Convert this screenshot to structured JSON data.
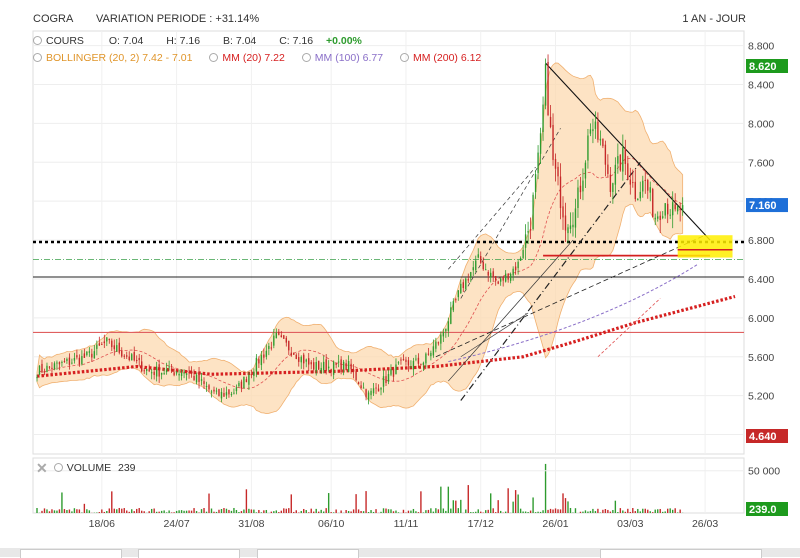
{
  "header": {
    "symbol": "COGRA",
    "variation": "VARIATION PERIODE : +31.14%",
    "period": "1 AN - JOUR"
  },
  "legend": {
    "cours_label": "COURS",
    "open": "O: 7.04",
    "high": "H: 7.16",
    "low": "B: 7.04",
    "close": "C: 7.16",
    "change": "+0.00%",
    "bollinger": "BOLLINGER (20, 2)  7.42 - 7.01",
    "mm20": "MM (20)  7.22",
    "mm100": "MM (100)  6.77",
    "mm200": "MM (200)  6.12"
  },
  "volume_panel": {
    "label": "VOLUME",
    "value": "239"
  },
  "colors": {
    "up": "#2e9b2e",
    "down": "#c62828",
    "band_fill": "#fcd9b0",
    "band_stroke": "#f0b070",
    "mm20": "#e05050",
    "mm100": "#8a6fc8",
    "mm200": "#d62020",
    "last_price_bg": "#1e6fd8",
    "high_badge_bg": "#1d9a1d",
    "low_badge_bg": "#c62828",
    "highlight": "#ffee00"
  },
  "chart_data": {
    "type": "candlestick",
    "y_ticks": [
      "8.800",
      "8.400",
      "8.000",
      "7.600",
      "7.200",
      "6.800",
      "6.400",
      "6.000",
      "5.600",
      "5.200",
      "4.800"
    ],
    "x_ticks": [
      "18/06",
      "24/07",
      "31/08",
      "06/10",
      "11/11",
      "17/12",
      "26/01",
      "03/03",
      "26/03"
    ],
    "ylim": [
      4.6,
      8.95
    ],
    "last_price": "7.160",
    "max_badge": "8.620",
    "min_badge": "4.640",
    "volume_ticks": [
      "50 000"
    ],
    "volume_last": "239.0",
    "key_points": [
      {
        "idx": 0,
        "price": 5.45
      },
      {
        "idx": 20,
        "price": 5.6
      },
      {
        "idx": 28,
        "price": 5.75
      },
      {
        "idx": 45,
        "price": 5.45
      },
      {
        "idx": 60,
        "price": 5.45
      },
      {
        "idx": 72,
        "price": 5.2
      },
      {
        "idx": 80,
        "price": 5.25
      },
      {
        "idx": 90,
        "price": 5.6
      },
      {
        "idx": 96,
        "price": 5.8
      },
      {
        "idx": 110,
        "price": 5.5
      },
      {
        "idx": 125,
        "price": 5.5
      },
      {
        "idx": 133,
        "price": 5.2
      },
      {
        "idx": 145,
        "price": 5.5
      },
      {
        "idx": 155,
        "price": 5.55
      },
      {
        "idx": 162,
        "price": 5.8
      },
      {
        "idx": 170,
        "price": 6.3
      },
      {
        "idx": 177,
        "price": 6.6
      },
      {
        "idx": 185,
        "price": 6.35
      },
      {
        "idx": 193,
        "price": 6.55
      },
      {
        "idx": 198,
        "price": 7.0
      },
      {
        "idx": 202,
        "price": 7.8
      },
      {
        "idx": 204,
        "price": 8.5
      },
      {
        "idx": 207,
        "price": 7.6
      },
      {
        "idx": 212,
        "price": 7.0
      },
      {
        "idx": 216,
        "price": 7.1
      },
      {
        "idx": 219,
        "price": 7.5
      },
      {
        "idx": 222,
        "price": 8.0
      },
      {
        "idx": 226,
        "price": 7.8
      },
      {
        "idx": 230,
        "price": 7.4
      },
      {
        "idx": 235,
        "price": 7.65
      },
      {
        "idx": 240,
        "price": 7.3
      },
      {
        "idx": 244,
        "price": 7.4
      },
      {
        "idx": 248,
        "price": 7.05
      },
      {
        "idx": 252,
        "price": 7.2
      },
      {
        "idx": 256,
        "price": 7.05
      },
      {
        "idx": 259,
        "price": 7.16
      }
    ],
    "mm200_points": [
      {
        "idx": 0,
        "price": 5.4
      },
      {
        "idx": 40,
        "price": 5.5
      },
      {
        "idx": 70,
        "price": 5.42
      },
      {
        "idx": 120,
        "price": 5.45
      },
      {
        "idx": 160,
        "price": 5.5
      },
      {
        "idx": 195,
        "price": 5.6
      },
      {
        "idx": 215,
        "price": 5.75
      },
      {
        "idx": 240,
        "price": 5.95
      },
      {
        "idx": 280,
        "price": 6.22
      }
    ],
    "horizontal_lines": [
      {
        "price": 6.78,
        "style": "dotted-black"
      },
      {
        "price": 6.6,
        "style": "dashdot-green"
      },
      {
        "price": 6.42,
        "style": "solid-black"
      },
      {
        "price": 5.85,
        "style": "solid-red"
      }
    ]
  }
}
